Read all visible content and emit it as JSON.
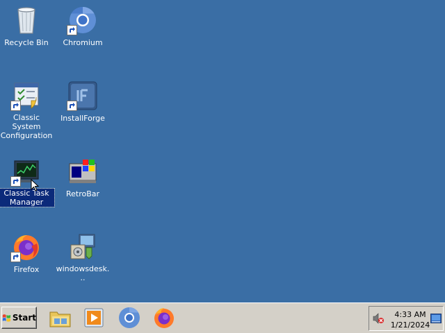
{
  "desktop": {
    "icons": [
      {
        "label": "Recycle Bin",
        "icon": "recycle-bin-icon",
        "shortcut": false
      },
      {
        "label": "Chromium",
        "icon": "chromium-icon",
        "shortcut": true
      },
      {
        "label": "Classic System Configuration",
        "icon": "system-configuration-icon",
        "shortcut": true
      },
      {
        "label": "InstallForge",
        "icon": "installforge-icon",
        "shortcut": true
      },
      {
        "label": "Classic Task Manager",
        "icon": "task-manager-icon",
        "shortcut": true,
        "selected": true
      },
      {
        "label": "RetroBar",
        "icon": "retrobar-icon",
        "shortcut": false
      },
      {
        "label": "Firefox",
        "icon": "firefox-icon",
        "shortcut": true
      },
      {
        "label": "windowsdesk...",
        "icon": "installer-package-icon",
        "shortcut": false
      }
    ],
    "background_color": "#3a6ea5",
    "selection_color": "#0b2a7a"
  },
  "taskbar": {
    "start_label": "Start",
    "quick_launch": [
      "file-explorer-icon",
      "media-player-icon",
      "chromium-icon",
      "firefox-icon"
    ],
    "tray": {
      "volume_icon": "volume-muted-icon",
      "time": "4:33 AM",
      "date": "1/21/2024",
      "show_desktop_icon": "show-desktop-icon"
    }
  }
}
